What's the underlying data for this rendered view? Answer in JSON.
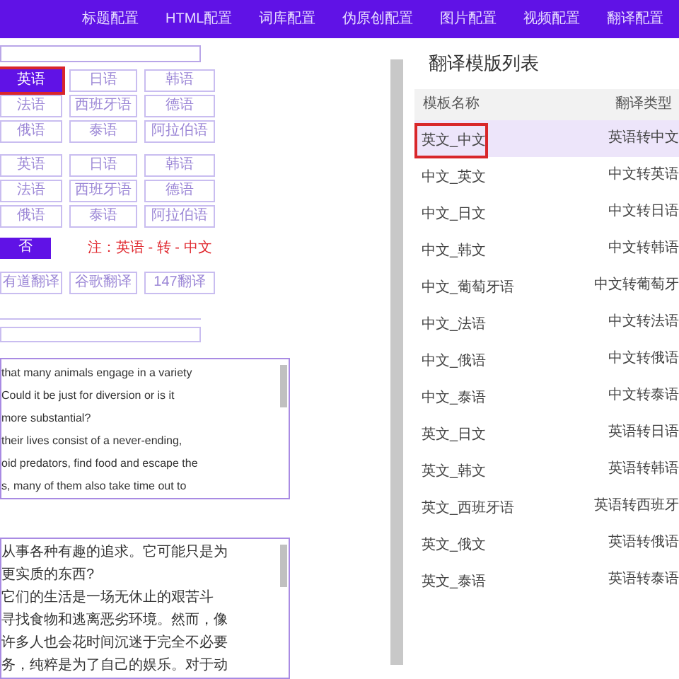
{
  "nav": [
    "标题配置",
    "HTML配置",
    "词库配置",
    "伪原创配置",
    "图片配置",
    "视频配置",
    "翻译配置"
  ],
  "language_groups": [
    {
      "buttons": [
        {
          "label": "英语",
          "selected": true
        },
        {
          "label": "日语",
          "selected": false
        },
        {
          "label": "韩语",
          "selected": false
        },
        {
          "label": "法语",
          "selected": false
        },
        {
          "label": "西班牙语",
          "selected": false
        },
        {
          "label": "德语",
          "selected": false
        },
        {
          "label": "俄语",
          "selected": false
        },
        {
          "label": "泰语",
          "selected": false
        },
        {
          "label": "阿拉伯语",
          "selected": false
        }
      ]
    },
    {
      "buttons": [
        {
          "label": "英语",
          "selected": false
        },
        {
          "label": "日语",
          "selected": false
        },
        {
          "label": "韩语",
          "selected": false
        },
        {
          "label": "法语",
          "selected": false
        },
        {
          "label": "西班牙语",
          "selected": false
        },
        {
          "label": "德语",
          "selected": false
        },
        {
          "label": "俄语",
          "selected": false
        },
        {
          "label": "泰语",
          "selected": false
        },
        {
          "label": "阿拉伯语",
          "selected": false
        }
      ]
    }
  ],
  "toggle_button": "否",
  "note": "注：英语 - 转 - 中文",
  "engines": [
    "有道翻译",
    "谷歌翻译",
    "147翻译"
  ],
  "source_text": [
    "that many animals engage in a variety",
    "Could it be just for diversion or is it",
    "more substantial?",
    "their lives consist of a never-ending,",
    "oid predators, find food and escape the",
    "s, many of them also take time out to"
  ],
  "target_text": [
    "从事各种有趣的追求。它可能只是为",
    "更实质的东西?",
    "它们的生活是一场无休止的艰苦斗",
    "寻找食物和逃离恶劣环境。然而，像",
    "许多人也会花时间沉迷于完全不必要",
    "务，纯粹是为了自己的娱乐。对于动"
  ],
  "template_panel": {
    "title": "翻译模版列表",
    "columns": [
      "模板名称",
      "翻译类型"
    ],
    "rows": [
      {
        "name": "英文_中文",
        "type": "英语转中文",
        "selected": true
      },
      {
        "name": "中文_英文",
        "type": "中文转英语",
        "selected": false
      },
      {
        "name": "中文_日文",
        "type": "中文转日语",
        "selected": false
      },
      {
        "name": "中文_韩文",
        "type": "中文转韩语",
        "selected": false
      },
      {
        "name": "中文_葡萄牙语",
        "type": "中文转葡萄牙",
        "selected": false
      },
      {
        "name": "中文_法语",
        "type": "中文转法语",
        "selected": false
      },
      {
        "name": "中文_俄语",
        "type": "中文转俄语",
        "selected": false
      },
      {
        "name": "中文_泰语",
        "type": "中文转泰语",
        "selected": false
      },
      {
        "name": "英文_日文",
        "type": "英语转日语",
        "selected": false
      },
      {
        "name": "英文_韩文",
        "type": "英语转韩语",
        "selected": false
      },
      {
        "name": "英文_西班牙语",
        "type": "英语转西班牙",
        "selected": false
      },
      {
        "name": "英文_俄文",
        "type": "英语转俄语",
        "selected": false
      },
      {
        "name": "英文_泰语",
        "type": "英语转泰语",
        "selected": false
      }
    ]
  }
}
